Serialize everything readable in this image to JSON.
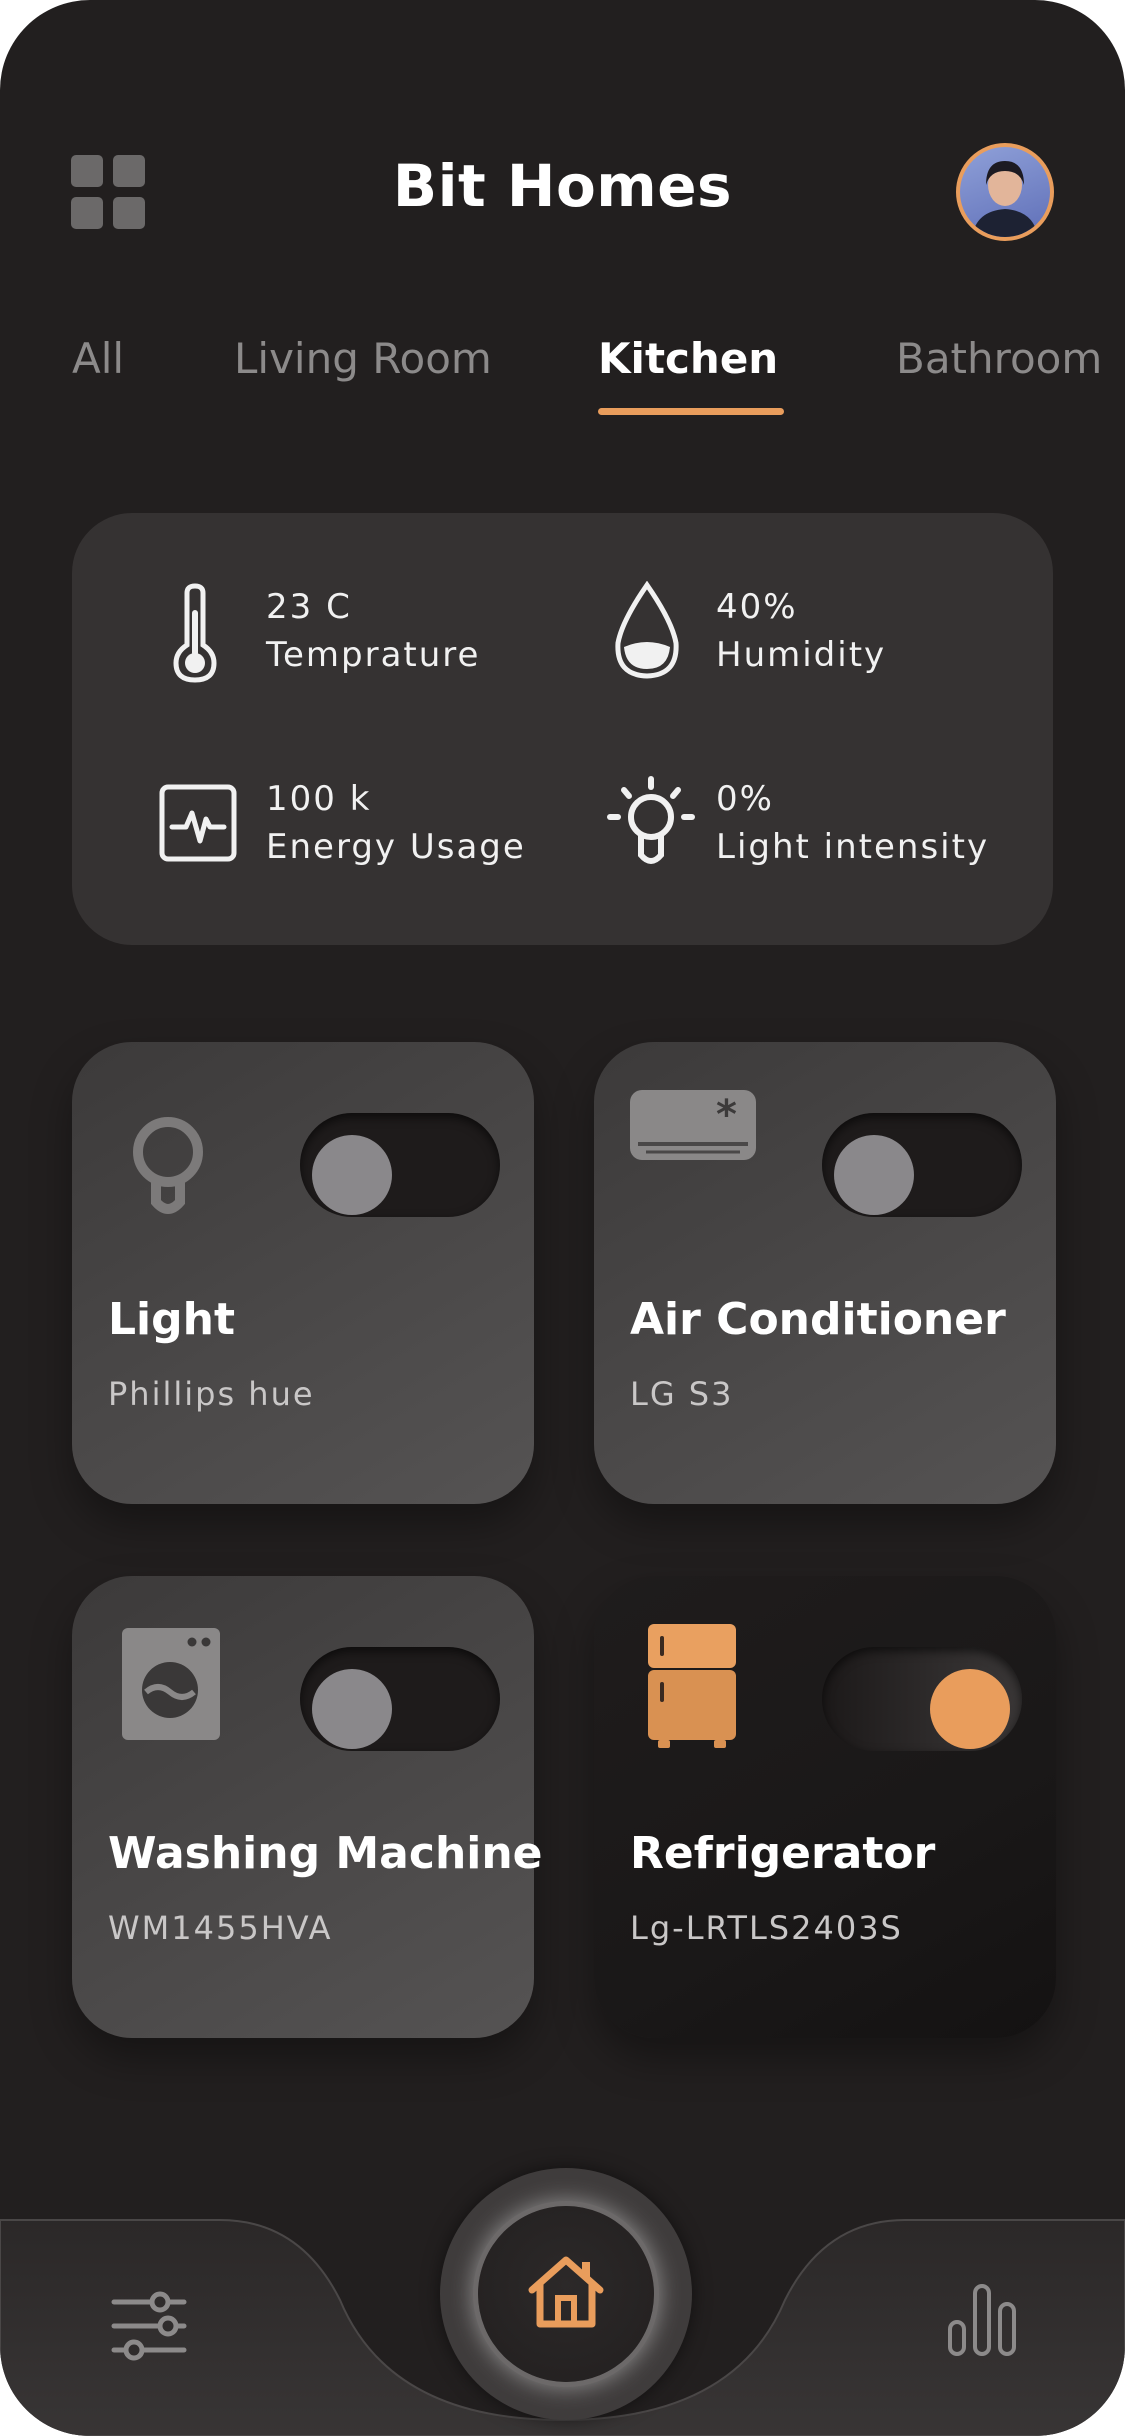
{
  "app": {
    "title": "Bit Homes"
  },
  "tabs": [
    {
      "label": "All",
      "active": false
    },
    {
      "label": "Living Room",
      "active": false
    },
    {
      "label": "Kitchen",
      "active": true
    },
    {
      "label": "Bathroom",
      "active": false
    }
  ],
  "stats": [
    {
      "value": "23 C",
      "label": "Temprature",
      "icon": "thermometer-icon"
    },
    {
      "value": "40%",
      "label": "Humidity",
      "icon": "water-drop-icon"
    },
    {
      "value": "100 k",
      "label": "Energy Usage",
      "icon": "pulse-icon"
    },
    {
      "value": "0%",
      "label": "Light intensity",
      "icon": "lightbulb-rays-icon"
    }
  ],
  "devices": [
    {
      "name": "Light",
      "model": "Phillips hue",
      "on": false,
      "icon": "lightbulb-icon"
    },
    {
      "name": "Air Conditioner",
      "model": "LG S3",
      "on": false,
      "icon": "air-conditioner-icon"
    },
    {
      "name": "Washing Machine",
      "model": "WM1455HVA",
      "on": false,
      "icon": "washing-machine-icon"
    },
    {
      "name": "Refrigerator",
      "model": "Lg-LRTLS2403S",
      "on": true,
      "icon": "refrigerator-icon"
    }
  ],
  "nav": {
    "left_icon": "sliders-icon",
    "center_icon": "home-icon",
    "right_icon": "bar-chart-icon"
  },
  "colors": {
    "background": "#221f1f",
    "card": "#353232",
    "accent": "#e99d5c",
    "muted_text": "#8c8a8a"
  }
}
